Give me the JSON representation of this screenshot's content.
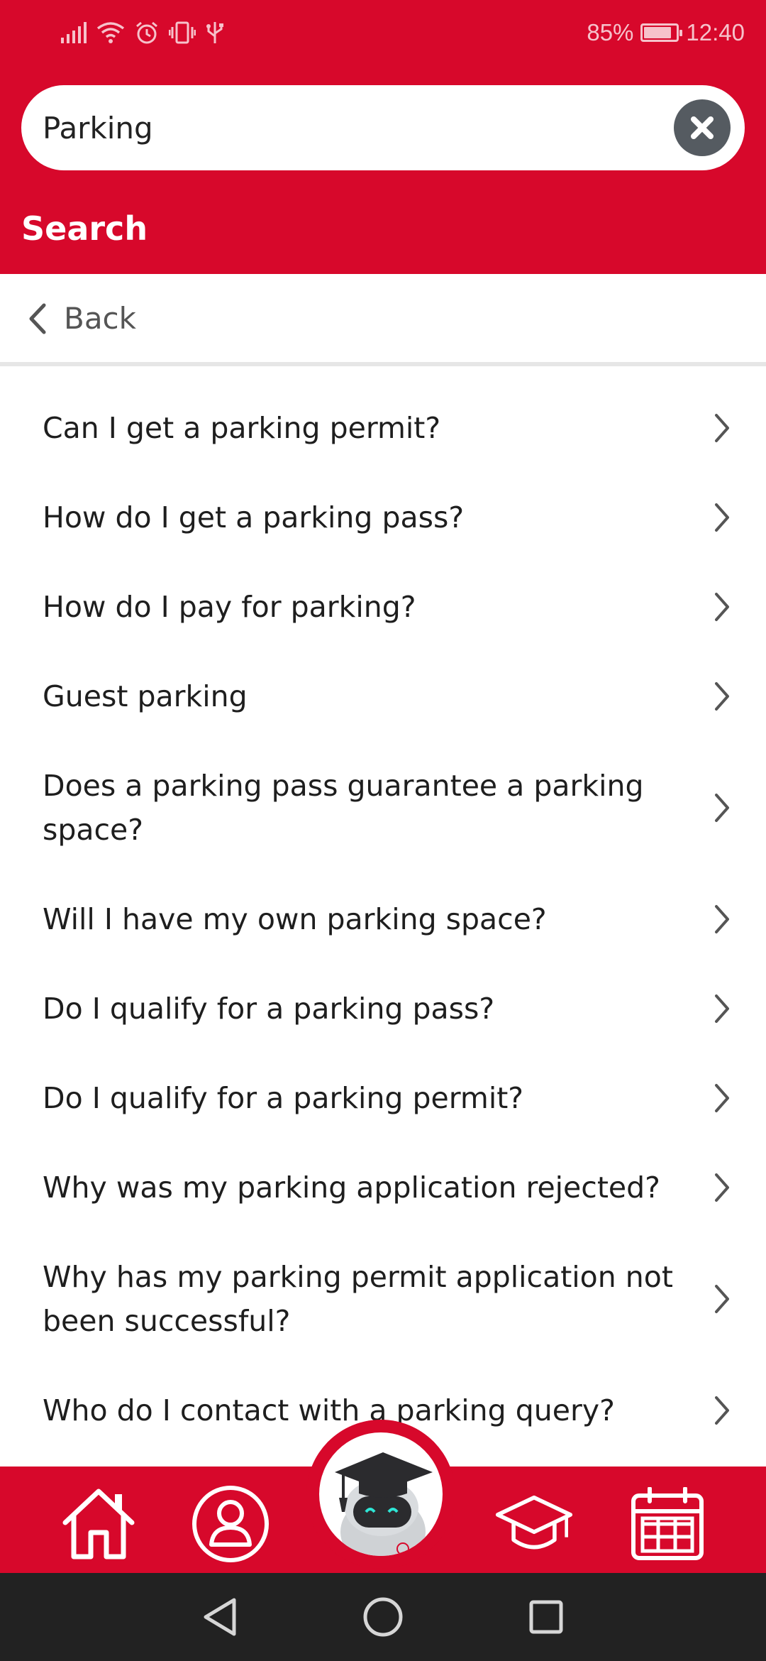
{
  "status_bar": {
    "battery_percent": "85%",
    "battery_level": 0.85,
    "time": "12:40",
    "icons": [
      "signal-icon",
      "wifi-icon",
      "alarm-icon",
      "vibrate-icon",
      "usb-icon",
      "battery-charging-icon"
    ]
  },
  "search": {
    "value": "Parking",
    "clear_icon": "close-icon"
  },
  "header": {
    "title": "Search"
  },
  "back": {
    "label": "Back"
  },
  "results": [
    {
      "label": "Can I get a parking permit?"
    },
    {
      "label": "How do I get a parking pass?"
    },
    {
      "label": "How do I pay for parking?"
    },
    {
      "label": "Guest parking"
    },
    {
      "label": "Does a parking pass guarantee a parking space?"
    },
    {
      "label": "Will I have my own parking space?"
    },
    {
      "label": "Do I qualify for a parking pass?"
    },
    {
      "label": "Do I qualify for a parking permit?"
    },
    {
      "label": "Why was my parking application rejected?"
    },
    {
      "label": "Why has my parking permit application not been successful?"
    },
    {
      "label": "Who do I contact with a parking query?"
    }
  ],
  "bottom_nav": {
    "items": [
      "home-icon",
      "profile-icon",
      "assistant-bot-icon",
      "graduation-cap-icon",
      "calendar-icon"
    ]
  },
  "system_nav": {
    "items": [
      "back-triangle-icon",
      "home-circle-icon",
      "recents-square-icon"
    ]
  },
  "colors": {
    "brand_red": "#d7082b",
    "text_dark": "#1e1e1e",
    "system_bar": "#222222"
  }
}
